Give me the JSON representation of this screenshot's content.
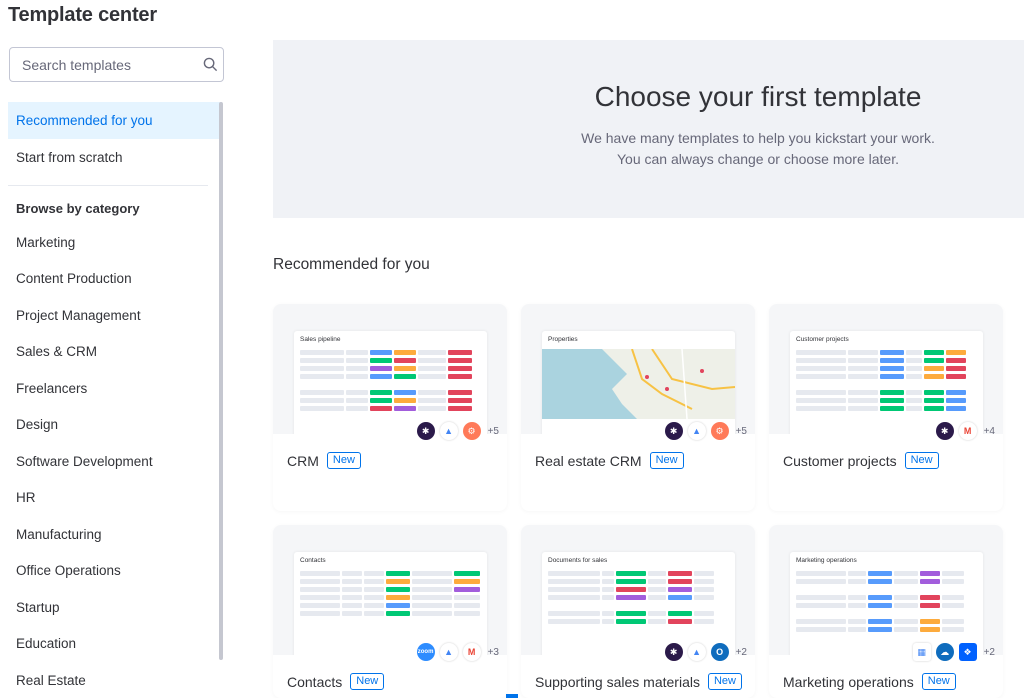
{
  "page": {
    "title": "Template center"
  },
  "search": {
    "placeholder": "Search templates"
  },
  "sidebar": {
    "top_items": [
      {
        "label": "Recommended for you",
        "active": true
      },
      {
        "label": "Start from scratch",
        "active": false
      }
    ],
    "browse_heading": "Browse by category",
    "categories": [
      "Marketing",
      "Content Production",
      "Project Management",
      "Sales & CRM",
      "Freelancers",
      "Design",
      "Software Development",
      "HR",
      "Manufacturing",
      "Office Operations",
      "Startup",
      "Education",
      "Real Estate"
    ]
  },
  "hero": {
    "title": "Choose your first template",
    "line1": "We have many templates to help you kickstart your work.",
    "line2": "You can always change or choose more later."
  },
  "section": {
    "title": "Recommended for you"
  },
  "cards": [
    {
      "name": "CRM",
      "badge": "New",
      "preview_title": "Sales pipeline",
      "more": "+5",
      "icons": [
        "slack-icon",
        "drive-icon",
        "hubspot-icon"
      ]
    },
    {
      "name": "Real estate CRM",
      "badge": "New",
      "preview_title": "Properties",
      "more": "+5",
      "icons": [
        "slack-icon",
        "drive-icon",
        "hubspot-icon"
      ]
    },
    {
      "name": "Customer projects",
      "badge": "New",
      "preview_title": "Customer projects",
      "more": "+4",
      "icons": [
        "slack-icon",
        "gmail-icon"
      ]
    },
    {
      "name": "Contacts",
      "badge": "New",
      "preview_title": "Contacts",
      "more": "+3",
      "icons": [
        "zoom-icon",
        "drive-icon",
        "gmail-icon"
      ]
    },
    {
      "name": "Supporting sales materials",
      "badge": "New",
      "preview_title": "Documents for sales",
      "more": "+2",
      "icons": [
        "slack-icon",
        "drive-icon",
        "outlook-icon"
      ]
    },
    {
      "name": "Marketing operations",
      "badge": "New",
      "preview_title": "Marketing operations",
      "more": "+2",
      "icons": [
        "calendar-icon",
        "cloud-icon",
        "dropbox-icon"
      ]
    }
  ],
  "colors": {
    "accent": "#0073ea",
    "active_bg": "#e5f4ff",
    "hero_bg": "#f0f2f6",
    "status_green": "#00c875",
    "status_orange": "#fdab3d",
    "status_red": "#e2445c",
    "status_purple": "#a25ddc",
    "status_blue": "#579bfc"
  }
}
